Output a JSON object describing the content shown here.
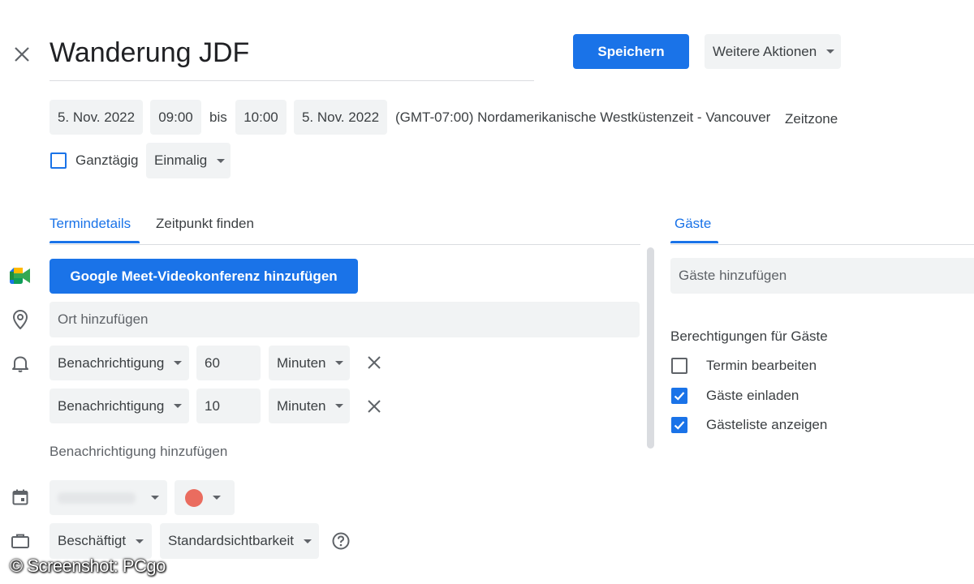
{
  "header": {
    "title": "Wanderung JDF",
    "save_label": "Speichern",
    "more_actions_label": "Weitere Aktionen"
  },
  "datetime": {
    "start_date": "5. Nov. 2022",
    "start_time": "09:00",
    "to_label": "bis",
    "end_time": "10:00",
    "end_date": "5. Nov. 2022",
    "timezone_text": "(GMT-07:00) Nordamerikanische Westküstenzeit - Vancouver",
    "timezone_link": "Zeitzone",
    "all_day_label": "Ganztägig",
    "recurrence_value": "Einmalig"
  },
  "tabs": {
    "details": "Termindetails",
    "find_time": "Zeitpunkt finden",
    "guests": "Gäste"
  },
  "details": {
    "meet_button": "Google Meet-Videokonferenz hinzufügen",
    "location_placeholder": "Ort hinzufügen",
    "notifications": [
      {
        "type": "Benachrichtigung",
        "value": "60",
        "unit": "Minuten"
      },
      {
        "type": "Benachrichtigung",
        "value": "10",
        "unit": "Minuten"
      }
    ],
    "add_notification": "Benachrichtigung hinzufügen",
    "calendar_color": "#ea6c5f",
    "availability": "Beschäftigt",
    "visibility": "Standardsichtbarkeit"
  },
  "guests": {
    "add_placeholder": "Gäste hinzufügen",
    "permissions_title": "Berechtigungen für Gäste",
    "permissions": [
      {
        "label": "Termin bearbeiten",
        "checked": false
      },
      {
        "label": "Gäste einladen",
        "checked": true
      },
      {
        "label": "Gästeliste anzeigen",
        "checked": true
      }
    ]
  },
  "watermark": "© Screenshot: PCgo",
  "colors": {
    "accent": "#1a73e8",
    "chip_bg": "#f1f3f4",
    "text": "#3c4043"
  }
}
